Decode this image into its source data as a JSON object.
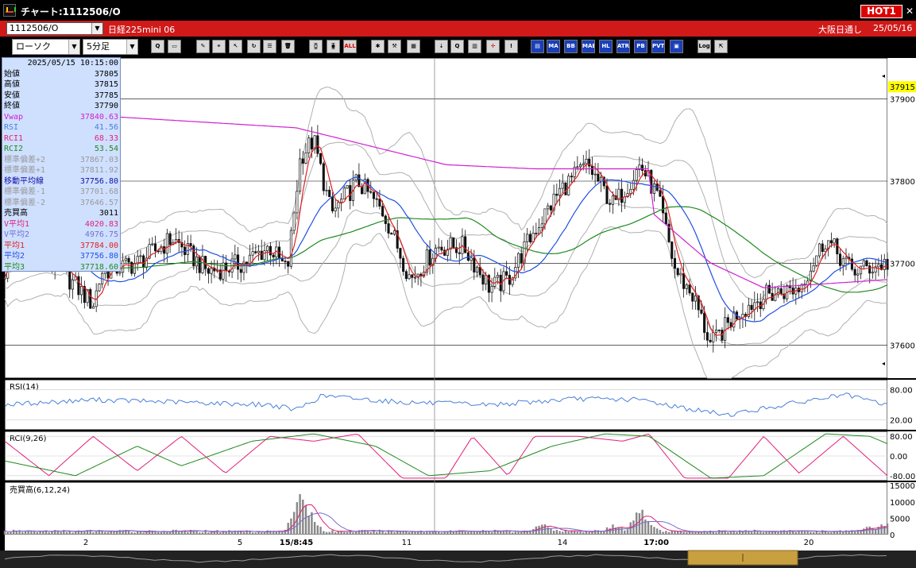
{
  "window": {
    "title": "チャート:1112506/O",
    "hot_label": "HOT1",
    "close_glyph": "✕"
  },
  "symbol_bar": {
    "code": "1112506/O",
    "name": "日経225mini 06",
    "session": "大阪日通し",
    "date": "25/05/16"
  },
  "toolbar": {
    "chart_type": "ローソク",
    "interval": "5分足",
    "buttons": [
      {
        "name": "zoom-icon",
        "label": "Q",
        "style": "normal"
      },
      {
        "name": "window-icon",
        "label": "▭",
        "style": "normal"
      },
      {
        "name": "pen-icon",
        "label": "✎",
        "style": "normal"
      },
      {
        "name": "link-icon",
        "label": "⚭",
        "style": "normal"
      },
      {
        "name": "cursor-icon",
        "label": "↖",
        "style": "normal"
      },
      {
        "name": "refresh-icon",
        "label": "↻",
        "style": "normal"
      },
      {
        "name": "memo-icon",
        "label": "☰",
        "style": "normal"
      },
      {
        "name": "trash-icon",
        "label": "🗑",
        "style": "normal"
      },
      {
        "name": "candle-icon",
        "label": "⧮",
        "style": "normal"
      },
      {
        "name": "candle-alt-icon",
        "label": "⧯",
        "style": "normal"
      },
      {
        "name": "all-icon",
        "label": "ALL",
        "style": "red"
      },
      {
        "name": "settings-icon",
        "label": "✱",
        "style": "normal"
      },
      {
        "name": "tools-icon",
        "label": "⚒",
        "style": "normal"
      },
      {
        "name": "palette-icon",
        "label": "▦",
        "style": "normal"
      },
      {
        "name": "order-icon",
        "label": "⇣",
        "style": "normal"
      },
      {
        "name": "magnify-icon",
        "label": "Q",
        "style": "normal"
      },
      {
        "name": "bar-chart-icon",
        "label": "▥",
        "style": "normal"
      },
      {
        "name": "crosshair-icon",
        "label": "✛",
        "style": "red"
      },
      {
        "name": "disabled-icon",
        "label": "!",
        "style": "normal"
      },
      {
        "name": "indicator-icon",
        "label": "▤",
        "style": "blue"
      },
      {
        "name": "ma-icon",
        "label": "MA",
        "style": "blue"
      },
      {
        "name": "bb-icon",
        "label": "BB",
        "style": "blue"
      },
      {
        "name": "mae-icon",
        "label": "MAE",
        "style": "blue"
      },
      {
        "name": "hl-icon",
        "label": "HL",
        "style": "blue"
      },
      {
        "name": "atr-icon",
        "label": "ATR",
        "style": "blue"
      },
      {
        "name": "pb-icon",
        "label": "PB",
        "style": "blue"
      },
      {
        "name": "pvt-icon",
        "label": "PVT",
        "style": "blue"
      },
      {
        "name": "frame-icon",
        "label": "▣",
        "style": "blue"
      },
      {
        "name": "log-icon",
        "label": "Log",
        "style": "normal"
      },
      {
        "name": "export-icon",
        "label": "⇱",
        "style": "normal"
      }
    ]
  },
  "info_panel": {
    "timestamp": "2025/05/15  10:15:00",
    "rows": [
      {
        "key": "始値",
        "value": "37805",
        "color": "#000000"
      },
      {
        "key": "高値",
        "value": "37815",
        "color": "#000000"
      },
      {
        "key": "安値",
        "value": "37785",
        "color": "#000000"
      },
      {
        "key": "終値",
        "value": "37790",
        "color": "#000000"
      },
      {
        "key": "Vwap",
        "value": "37840.63",
        "color": "#d020d0"
      },
      {
        "key": "RSI",
        "value": "41.56",
        "color": "#4a7fd8"
      },
      {
        "key": "RCI1",
        "value": "68.33",
        "color": "#e0207a"
      },
      {
        "key": "RCI2",
        "value": "53.54",
        "color": "#208a20"
      },
      {
        "key": "標準偏差+2",
        "value": "37867.03",
        "color": "#999999"
      },
      {
        "key": "標準偏差+1",
        "value": "37811.92",
        "color": "#999999"
      },
      {
        "key": "移動平均線",
        "value": "37756.80",
        "color": "#1010a0"
      },
      {
        "key": "標準偏差-1",
        "value": "37701.68",
        "color": "#999999"
      },
      {
        "key": "標準偏差-2",
        "value": "37646.57",
        "color": "#999999"
      },
      {
        "key": "売買高",
        "value": "3011",
        "color": "#000000"
      },
      {
        "key": "V平均1",
        "value": "4020.83",
        "color": "#e0207a"
      },
      {
        "key": "V平均2",
        "value": "4976.75",
        "color": "#7070d0"
      },
      {
        "key": "平均1",
        "value": "37784.00",
        "color": "#e02020"
      },
      {
        "key": "平均2",
        "value": "37756.80",
        "color": "#2050e0"
      },
      {
        "key": "平均3",
        "value": "37718.60",
        "color": "#208a20"
      }
    ]
  },
  "colors": {
    "title_bg": "#000000",
    "symbol_bar_bg": "#d01a1a",
    "candle": "#111111",
    "ma_short": "#e02020",
    "ma_mid": "#2050e0",
    "ma_long": "#208a20",
    "vwap": "#d020d0",
    "bollinger": "#b0b0b0",
    "rsi": "#4a7fd8",
    "rci1": "#e0207a",
    "rci2": "#208a20",
    "volume": "#888888",
    "last_price_bg": "#ffff00"
  },
  "chart_data": [
    {
      "type": "candlestick",
      "interval": "5分足",
      "last_price_label": "37915",
      "y_ticks": [
        "37900",
        "37800",
        "37700",
        "37600"
      ],
      "ylim": [
        37560,
        37950
      ],
      "x_ticks": [
        "2",
        "5",
        "15/8:45",
        "11",
        "14",
        "17:00",
        "20"
      ],
      "indicators": [
        "Vwap",
        "移動平均線",
        "標準偏差±1",
        "標準偏差±2",
        "平均1",
        "平均2",
        "平均3"
      ],
      "anchors": [
        {
          "t": 0.0,
          "c": 37690
        },
        {
          "t": 0.03,
          "c": 37730
        },
        {
          "t": 0.1,
          "c": 37650
        },
        {
          "t": 0.11,
          "c": 37690
        },
        {
          "t": 0.15,
          "c": 37700
        },
        {
          "t": 0.19,
          "c": 37730
        },
        {
          "t": 0.23,
          "c": 37690
        },
        {
          "t": 0.27,
          "c": 37700
        },
        {
          "t": 0.3,
          "c": 37720
        },
        {
          "t": 0.32,
          "c": 37690
        },
        {
          "t": 0.335,
          "c": 37830
        },
        {
          "t": 0.35,
          "c": 37850
        },
        {
          "t": 0.37,
          "c": 37760
        },
        {
          "t": 0.4,
          "c": 37800
        },
        {
          "t": 0.43,
          "c": 37760
        },
        {
          "t": 0.46,
          "c": 37680
        },
        {
          "t": 0.49,
          "c": 37720
        },
        {
          "t": 0.52,
          "c": 37720
        },
        {
          "t": 0.55,
          "c": 37670
        },
        {
          "t": 0.57,
          "c": 37680
        },
        {
          "t": 0.6,
          "c": 37740
        },
        {
          "t": 0.63,
          "c": 37790
        },
        {
          "t": 0.66,
          "c": 37820
        },
        {
          "t": 0.69,
          "c": 37770
        },
        {
          "t": 0.72,
          "c": 37820
        },
        {
          "t": 0.74,
          "c": 37780
        },
        {
          "t": 0.76,
          "c": 37690
        },
        {
          "t": 0.78,
          "c": 37660
        },
        {
          "t": 0.8,
          "c": 37600
        },
        {
          "t": 0.83,
          "c": 37640
        },
        {
          "t": 0.86,
          "c": 37660
        },
        {
          "t": 0.9,
          "c": 37670
        },
        {
          "t": 0.93,
          "c": 37730
        },
        {
          "t": 0.96,
          "c": 37690
        },
        {
          "t": 1.0,
          "c": 37700
        }
      ]
    },
    {
      "type": "line",
      "title": "RSI(14)",
      "y_ticks": [
        "80.00",
        "20.00"
      ],
      "ylim": [
        0,
        100
      ],
      "series": [
        {
          "name": "RSI",
          "anchors": [
            [
              0,
              50
            ],
            [
              0.1,
              60
            ],
            [
              0.2,
              55
            ],
            [
              0.3,
              50
            ],
            [
              0.33,
              40
            ],
            [
              0.36,
              68
            ],
            [
              0.45,
              55
            ],
            [
              0.55,
              50
            ],
            [
              0.65,
              62
            ],
            [
              0.72,
              60
            ],
            [
              0.78,
              40
            ],
            [
              0.82,
              30
            ],
            [
              0.9,
              55
            ],
            [
              0.95,
              70
            ],
            [
              1.0,
              50
            ]
          ]
        }
      ]
    },
    {
      "type": "line",
      "title": "RCI(9,26)",
      "y_ticks": [
        "80.00",
        "0.00",
        "-80.00"
      ],
      "ylim": [
        -100,
        100
      ],
      "series": [
        {
          "name": "RCI1",
          "anchors": [
            [
              0,
              60
            ],
            [
              0.05,
              -80
            ],
            [
              0.1,
              80
            ],
            [
              0.15,
              -60
            ],
            [
              0.2,
              80
            ],
            [
              0.25,
              -70
            ],
            [
              0.3,
              80
            ],
            [
              0.35,
              60
            ],
            [
              0.4,
              90
            ],
            [
              0.45,
              -90
            ],
            [
              0.5,
              -90
            ],
            [
              0.53,
              80
            ],
            [
              0.57,
              -80
            ],
            [
              0.6,
              80
            ],
            [
              0.65,
              80
            ],
            [
              0.7,
              60
            ],
            [
              0.73,
              90
            ],
            [
              0.77,
              -90
            ],
            [
              0.82,
              -90
            ],
            [
              0.86,
              80
            ],
            [
              0.9,
              -70
            ],
            [
              0.95,
              80
            ],
            [
              1.0,
              -80
            ]
          ]
        },
        {
          "name": "RCI2",
          "anchors": [
            [
              0,
              -20
            ],
            [
              0.08,
              -80
            ],
            [
              0.15,
              40
            ],
            [
              0.2,
              -40
            ],
            [
              0.28,
              60
            ],
            [
              0.35,
              90
            ],
            [
              0.42,
              40
            ],
            [
              0.48,
              -80
            ],
            [
              0.55,
              -60
            ],
            [
              0.62,
              40
            ],
            [
              0.68,
              90
            ],
            [
              0.73,
              80
            ],
            [
              0.8,
              -90
            ],
            [
              0.86,
              -80
            ],
            [
              0.93,
              90
            ],
            [
              0.98,
              80
            ],
            [
              1.0,
              50
            ]
          ]
        }
      ]
    },
    {
      "type": "bar",
      "title": "売買高(6,12,24)",
      "y_ticks": [
        "15000",
        "10000",
        "5000",
        "0"
      ],
      "ylim": [
        0,
        16000
      ],
      "spikes": [
        [
          0.335,
          14000
        ],
        [
          0.345,
          8000
        ],
        [
          0.61,
          4500
        ],
        [
          0.69,
          4000
        ],
        [
          0.72,
          9000
        ],
        [
          0.73,
          5000
        ],
        [
          0.98,
          3000
        ],
        [
          1.0,
          5000
        ]
      ]
    }
  ]
}
